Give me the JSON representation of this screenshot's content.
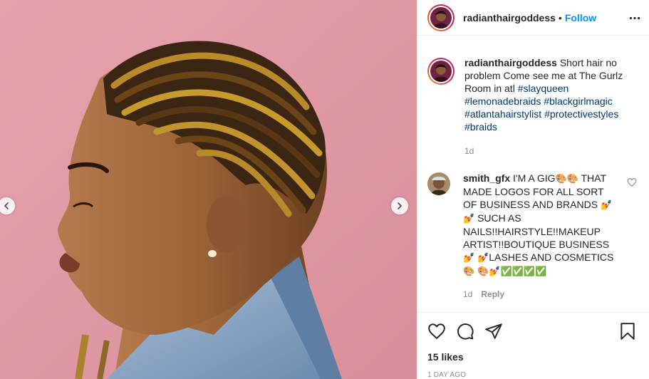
{
  "post": {
    "author": "radianthairgoddess",
    "separator": "•",
    "follow_label": "Follow",
    "caption_text": "Short hair no problem Come see me at The Gurlz Room in atl",
    "hashtags": [
      "#slayqueen",
      "#lemonadebraids",
      "#blackgirlmagic",
      "#atlantahairstylist",
      "#protectivestyles",
      "#braids"
    ],
    "caption_time": "1d",
    "likes": "15 likes",
    "date": "1 DAY AGO"
  },
  "comment": {
    "author": "smith_gfx",
    "text_1": "I'M A GIG",
    "text_2": "THAT MADE LOGOS FOR ALL SORT OF BUSINESS AND BRANDS",
    "text_3": "SUCH AS NAILS!!HAIRSTYLE!!MAKEUP ARTIST!!BOUTIQUE BUSINESS",
    "text_4": "LASHES AND COSMETICS",
    "time": "1d",
    "reply_label": "Reply"
  },
  "emoji": {
    "palette": "🎨",
    "brush": "💅",
    "check": "✅"
  },
  "icons": {
    "more": "more-horizontal-icon",
    "like": "heart-icon",
    "comment": "comment-icon",
    "share": "paper-plane-icon",
    "save": "bookmark-icon",
    "prev": "chevron-left-icon",
    "next": "chevron-right-icon"
  },
  "colors": {
    "follow": "#0095f6",
    "hashtag": "#00376b",
    "muted": "#8e8e8e",
    "background_pink": "#e09aa4"
  }
}
